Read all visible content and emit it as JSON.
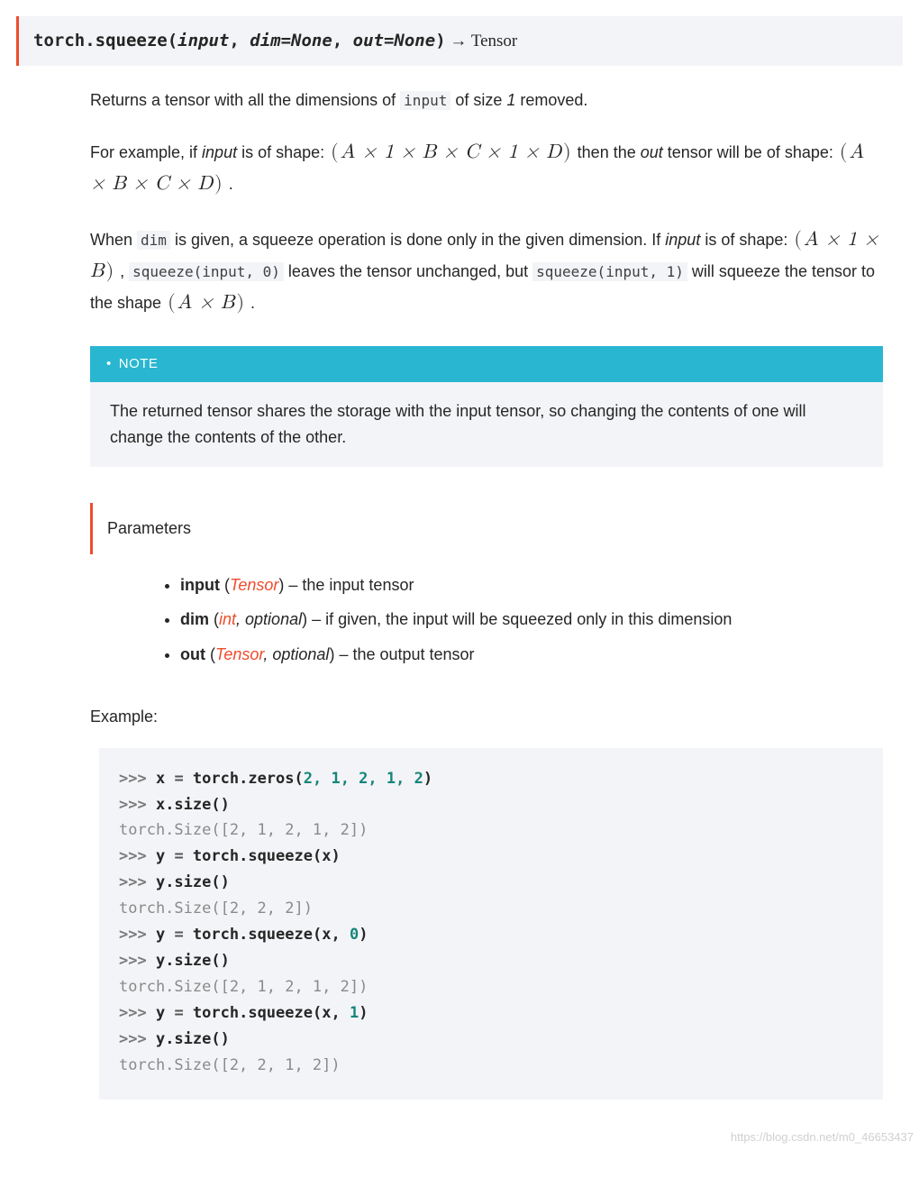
{
  "signature": {
    "namespace": "torch.",
    "name": "squeeze",
    "open": "(",
    "args": {
      "a1": "input",
      "c1": ", ",
      "a2": "dim=None",
      "c2": ", ",
      "a3": "out=None"
    },
    "close": ")",
    "arrow": " → ",
    "returns": "Tensor"
  },
  "desc": {
    "p1a": "Returns a tensor with all the dimensions of ",
    "p1_code": "input",
    "p1b": " of size ",
    "p1_one": "1",
    "p1c": " removed.",
    "p2a": "For example, if ",
    "p2_it1": "input",
    "p2b": " is of shape: ",
    "p2_math1_open": "(",
    "p2_math1": "A × 1 × B × C × 1 × D",
    "p2_math1_close": ")",
    "p2c": " then the ",
    "p2_it2": "out",
    "p2d": " tensor will be of shape: ",
    "p2_math2_open": "(",
    "p2_math2": "A × B × C × D",
    "p2_math2_close": ")",
    "p2e": " .",
    "p3a": "When ",
    "p3_code1": "dim",
    "p3b": " is given, a squeeze operation is done only in the given dimension. If ",
    "p3_it1": "input",
    "p3c": " is of shape: ",
    "p3_math1_open": "(",
    "p3_math1": "A × 1 × B",
    "p3_math1_close": ")",
    "p3d": " , ",
    "p3_code2": "squeeze(input, 0)",
    "p3e": " leaves the tensor unchanged, but ",
    "p3_code3": "squeeze(input, 1)",
    "p3f": " will squeeze the tensor to the shape ",
    "p3_math2_open": "(",
    "p3_math2": "A × B",
    "p3_math2_close": ")",
    "p3g": " ."
  },
  "note": {
    "title": "NOTE",
    "body": "The returned tensor shares the storage with the input tensor, so changing the contents of one will change the contents of the other."
  },
  "params": {
    "heading": "Parameters",
    "items": [
      {
        "name": "input",
        "type_link": "Tensor",
        "opt": "",
        "desc": " – the input tensor"
      },
      {
        "name": "dim",
        "type_link": "int",
        "opt": ", optional",
        "desc": " – if given, the input will be squeezed only in this dimension"
      },
      {
        "name": "out",
        "type_link": "Tensor",
        "opt": ", optional",
        "desc": " – the output tensor"
      }
    ]
  },
  "example": {
    "label": "Example:",
    "code": {
      "l1": {
        "pr": ">>> ",
        "v": "x",
        "eq": " = ",
        "fn": "torch.zeros",
        "p": "(",
        "a": "2, 1, 2, 1, 2",
        "cp": ")"
      },
      "l2": {
        "pr": ">>> ",
        "v": "x.size",
        "p": "()"
      },
      "l3": "torch.Size([2, 1, 2, 1, 2])",
      "l4": {
        "pr": ">>> ",
        "v": "y",
        "eq": " = ",
        "fn": "torch.squeeze",
        "p": "(x)"
      },
      "l5": {
        "pr": ">>> ",
        "v": "y.size",
        "p": "()"
      },
      "l6": "torch.Size([2, 2, 2])",
      "l7": {
        "pr": ">>> ",
        "v": "y",
        "eq": " = ",
        "fn": "torch.squeeze",
        "p": "(x, ",
        "n": "0",
        "cp": ")"
      },
      "l8": {
        "pr": ">>> ",
        "v": "y.size",
        "p": "()"
      },
      "l9": "torch.Size([2, 1, 2, 1, 2])",
      "l10": {
        "pr": ">>> ",
        "v": "y",
        "eq": " = ",
        "fn": "torch.squeeze",
        "p": "(x, ",
        "n": "1",
        "cp": ")"
      },
      "l11": {
        "pr": ">>> ",
        "v": "y.size",
        "p": "()"
      },
      "l12": "torch.Size([2, 2, 1, 2])"
    }
  },
  "watermark": "https://blog.csdn.net/m0_46653437"
}
